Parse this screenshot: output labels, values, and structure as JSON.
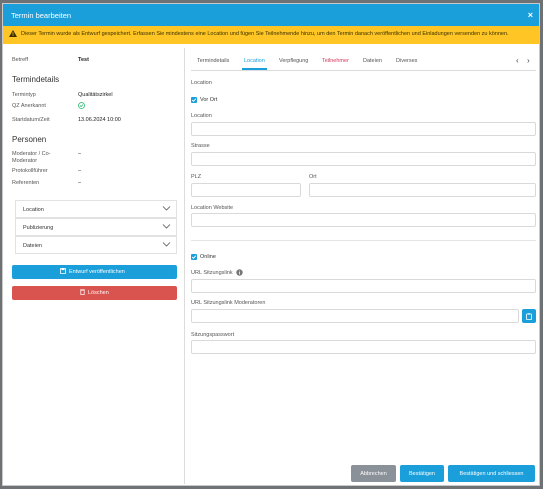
{
  "dialog": {
    "title": "Termin bearbeiten",
    "close_label": "×"
  },
  "warning": {
    "icon": "warning-triangle-icon",
    "text": "Dieser Termin wurde als Entwurf gespeichert. Erfassen Sie mindestens eine Location und fügen Sie Teilnehmende hinzu, um den Termin danach veröffentlichen und Einladungen versenden zu können."
  },
  "summary": {
    "betreff_label": "Betreff",
    "betreff_value": "Test",
    "termindetails_heading": "Termindetails",
    "termintyp_label": "Termintyp",
    "termintyp_value": "Qualitätszirkel",
    "qz_label": "QZ Anerkannt",
    "qz_icon": "check-circle-icon",
    "start_label": "Startdatum/Zeit",
    "start_value": "13.06.2024 10:00",
    "personen_heading": "Personen",
    "moderator_label_1": "Moderator / Co-",
    "moderator_label_2": "Moderator",
    "moderator_value": "–",
    "protokoll_label": "Protokollführer",
    "protokoll_value": "–",
    "referenten_label": "Referenten",
    "referenten_value": "–"
  },
  "accordion": [
    {
      "label": "Location"
    },
    {
      "label": "Publizierung"
    },
    {
      "label": "Dateien"
    }
  ],
  "actions": {
    "publish_label": "Entwurf veröffentlichen",
    "delete_label": "Löschen",
    "publish_color": "#1b9fdb",
    "delete_color": "#d9534f"
  },
  "tabs": [
    {
      "label": "Termindetails"
    },
    {
      "label": "Location"
    },
    {
      "label": "Verpflegung"
    },
    {
      "label": "Teilnehmer"
    },
    {
      "label": "Dateien"
    },
    {
      "label": "Diverses"
    }
  ],
  "tab_nav": {
    "prev": "‹",
    "next": "›"
  },
  "location_form": {
    "section_label": "Location",
    "vor_ort_label": "Vor Ort",
    "vor_ort_checked": true,
    "location_label": "Location",
    "location_value": "",
    "strasse_label": "Strasse",
    "strasse_value": "",
    "plz_label": "PLZ",
    "plz_value": "",
    "ort_label": "Ort",
    "ort_value": "",
    "website_label": "Location Website",
    "website_value": "",
    "online_label": "Online",
    "online_checked": true,
    "url_label": "URL Sitzungslink",
    "url_value": "",
    "url_mod_label": "URL Sitzungslink Moderatoren",
    "url_mod_value": "",
    "password_label": "Sitzungspasswort",
    "password_value": ""
  },
  "footer": {
    "cancel_label": "Abbrechen",
    "confirm_label": "Bestätigen",
    "confirm_close_label": "Bestätigen und schliessen",
    "cancel_color": "#8a9199",
    "confirm_color": "#1b9fdb"
  }
}
